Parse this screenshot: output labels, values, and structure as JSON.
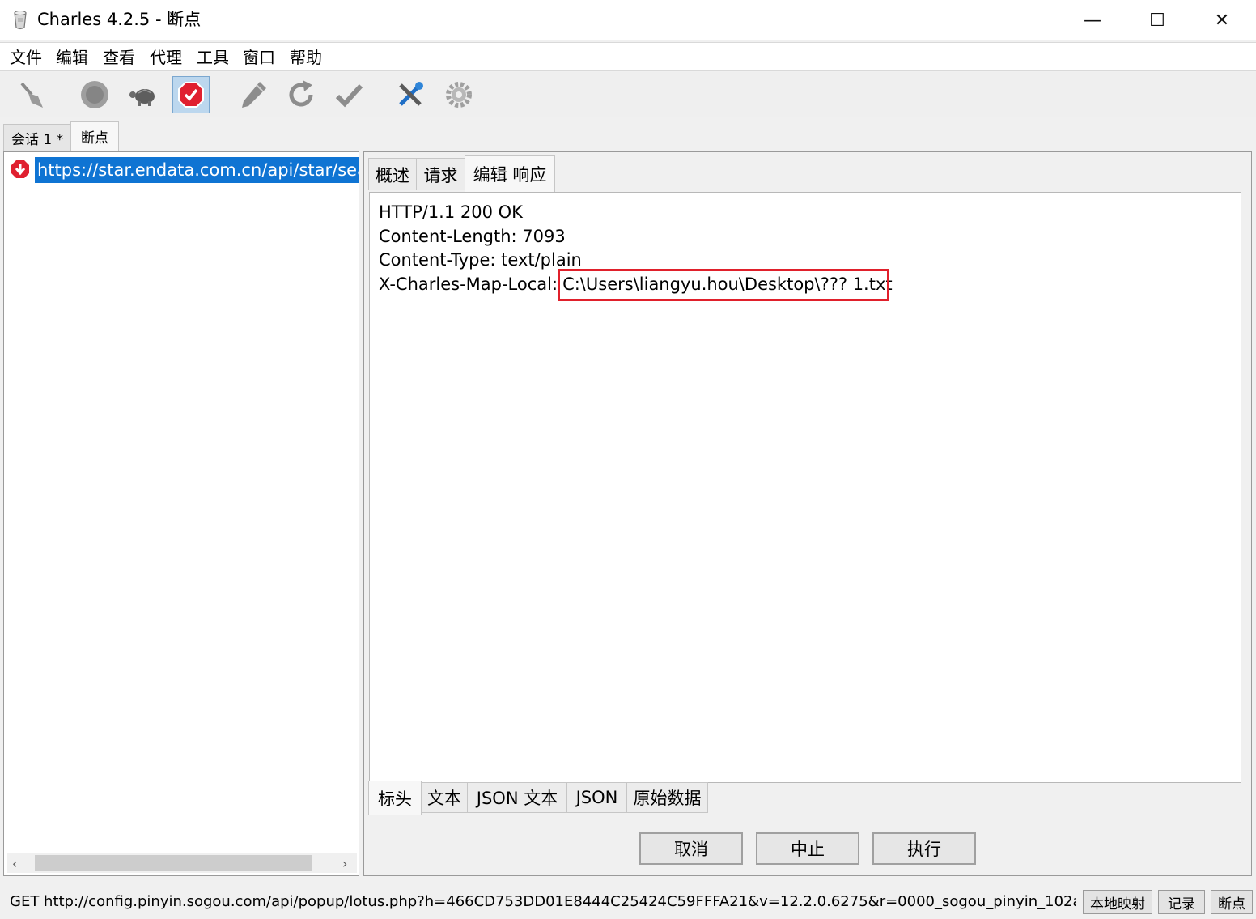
{
  "window": {
    "title": "Charles 4.2.5 - 断点",
    "minimize": "—",
    "maximize": "☐",
    "close": "✕"
  },
  "menu": [
    "文件",
    "编辑",
    "查看",
    "代理",
    "工具",
    "窗口",
    "帮助"
  ],
  "toolbar": {
    "icons": [
      "broom-icon",
      "record-icon",
      "turtle-throttle-icon",
      "breakpoint-icon",
      "pen-compose-icon",
      "repeat-icon",
      "validate-check-icon",
      "tools-icon",
      "settings-gear-icon"
    ],
    "active": "breakpoint-icon"
  },
  "session_tabs": [
    "会话 1 *",
    "断点"
  ],
  "left_list": {
    "items": [
      {
        "url": "https://star.endata.com.cn/api/star/sea",
        "icon": "breakpoint-response-icon",
        "selected": true
      }
    ]
  },
  "breakpoint_tabs": [
    "概述",
    "请求",
    "编辑 响应"
  ],
  "response_headers": [
    {
      "text": "HTTP/1.1 200 OK"
    },
    {
      "text": "Content-Length: 7093"
    },
    {
      "text": "Content-Type: text/plain"
    },
    {
      "name": "X-Charles-Map-Local:",
      "value": "C:\\Users\\liangyu.hou\\Desktop\\??? 1.txt"
    }
  ],
  "view_tabs": [
    "标头",
    "文本",
    "JSON 文本",
    "JSON",
    "原始数据"
  ],
  "actions": {
    "cancel": "取消",
    "abort": "中止",
    "execute": "执行"
  },
  "status": {
    "text": "GET http://config.pinyin.sogou.com/api/popup/lotus.php?h=466CD753DD01E8444C25424C59FFFA21&v=12.2.0.6275&r=0000_sogou_pinyin_102a&ppversion=...",
    "buttons": [
      "本地映射",
      "记录",
      "断点"
    ]
  },
  "colors": {
    "selection": "#0f74d3",
    "highlight_border": "#e0202b"
  }
}
